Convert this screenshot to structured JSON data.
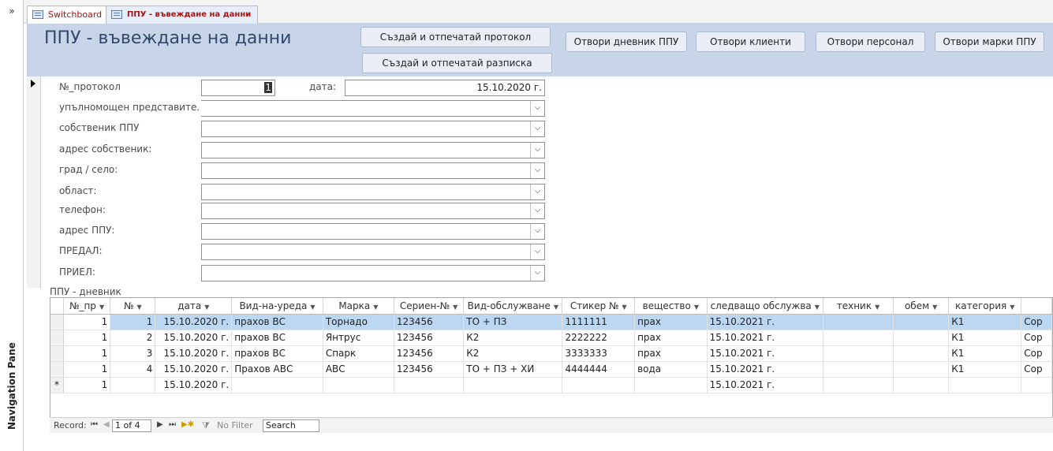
{
  "nav_pane": {
    "toggle_glyph": "»",
    "label": "Navigation Pane"
  },
  "tabs": [
    {
      "label": "Switchboard",
      "icon": "form-icon"
    },
    {
      "label": "ППУ - въвеждане на данни",
      "icon": "form-icon"
    }
  ],
  "header": {
    "title": "ППУ - въвеждане на данни",
    "buttons": {
      "create_protocol": "Създай и отпечатай протокол",
      "create_receipt": "Създай и отпечатай разписка",
      "open_log": "Отвори дневник ППУ",
      "open_clients": "Отвори клиенти",
      "open_staff": "Отвори персонал",
      "open_brands": "Отвори марки ППУ"
    },
    "colors": {
      "header_bg": "#c8d5e8",
      "title_color": "#31486c",
      "tab_text": "#a31515"
    }
  },
  "form": {
    "protocol_label": "№_протокол",
    "protocol_value": "1",
    "date_label": "дата:",
    "date_value": "15.10.2020 г.",
    "fields": [
      {
        "label": "упълномощен представите.",
        "value": ""
      },
      {
        "label": "собственик ППУ",
        "value": ""
      },
      {
        "label": "адрес собственик:",
        "value": ""
      },
      {
        "label": "град / село:",
        "value": ""
      },
      {
        "label": "област:",
        "value": ""
      },
      {
        "label": "телефон:",
        "value": ""
      },
      {
        "label": "адрес ППУ:",
        "value": ""
      },
      {
        "label": "ПРЕДАЛ:",
        "value": ""
      },
      {
        "label": "ПРИЕЛ:",
        "value": ""
      }
    ]
  },
  "subform": {
    "label": "ППУ - дневник",
    "columns": [
      "№_пр",
      "№",
      "дата",
      "Вид-на-уреда",
      "Марка",
      "Сериен-№",
      "Вид-обслужване",
      "Стикер №",
      "вещество",
      "следващо обслужва",
      "техник",
      "обем",
      "категория"
    ],
    "extra_column_fragment": "Сор",
    "rows": [
      [
        "1",
        "1",
        "15.10.2020 г.",
        "прахов ВС",
        "Торнадо",
        "123456",
        "ТО + ПЗ",
        "1111111",
        "прах",
        "15.10.2021 г.",
        "",
        "",
        "К1"
      ],
      [
        "1",
        "2",
        "15.10.2020 г.",
        "прахов ВС",
        "Янтрус",
        "123456",
        "К2",
        "2222222",
        "прах",
        "15.10.2021 г.",
        "",
        "",
        "К1"
      ],
      [
        "1",
        "3",
        "15.10.2020 г.",
        "прахов ВС",
        "Спарк",
        "123456",
        "К2",
        "3333333",
        "прах",
        "15.10.2021 г.",
        "",
        "",
        "К1"
      ],
      [
        "1",
        "4",
        "15.10.2020 г.",
        "Прахов АВС",
        "АВС",
        "123456",
        "ТО + ПЗ + ХИ",
        "4444444",
        "вода",
        "15.10.2021 г.",
        "",
        "",
        "К1"
      ]
    ],
    "new_row": {
      "marker": "*",
      "pr": "1",
      "date": "15.10.2020 г.",
      "next": "15.10.2021 г."
    }
  },
  "record_nav": {
    "label": "Record:",
    "position": "1 of 4",
    "filter": "No Filter",
    "search": "Search"
  }
}
